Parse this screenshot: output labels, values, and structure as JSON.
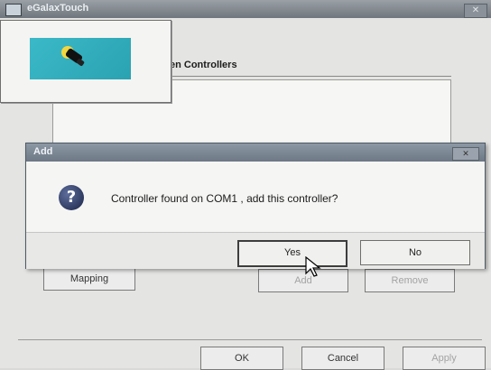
{
  "window": {
    "title": "eGalaxTouch",
    "close_glyph": "✕"
  },
  "tab": {
    "label": "en Controllers"
  },
  "background_buttons": {
    "mapping": "Mapping",
    "add": "Add",
    "remove": "Remove"
  },
  "footer": {
    "ok": "OK",
    "cancel": "Cancel",
    "apply": "Apply"
  },
  "dialog": {
    "title": "Add",
    "close_glyph": "✕",
    "message": "Controller found on COM1 , add this controller?",
    "icon": "question-icon",
    "yes": "Yes",
    "no": "No"
  },
  "colors": {
    "logo_bg": "#2aa2b1",
    "title_bar": "#6d7885"
  }
}
